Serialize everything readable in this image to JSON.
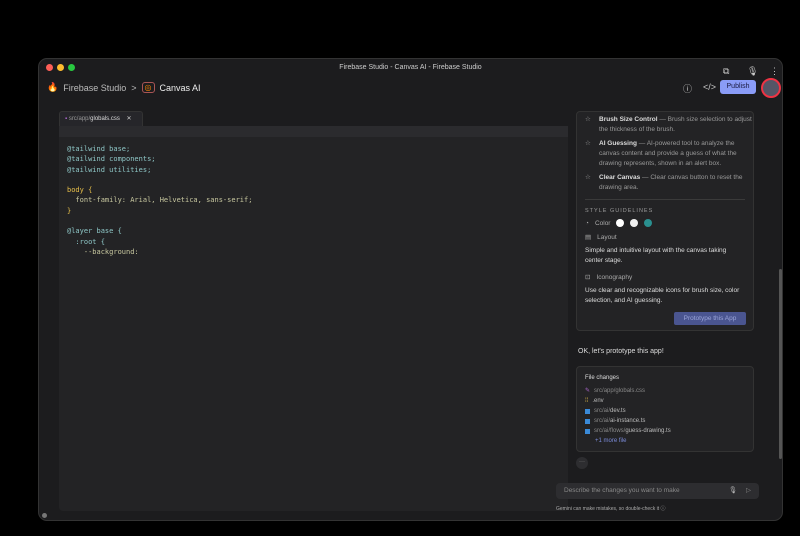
{
  "window": {
    "title": "Firebase Studio - Canvas AI - Firebase Studio"
  },
  "header": {
    "brand": "Firebase Studio",
    "separator": ">",
    "project": "Canvas AI",
    "publish_label": "Publish"
  },
  "editor": {
    "tab_dir": "src/app/",
    "tab_file": "globals.css",
    "code": [
      "@tailwind base;",
      "@tailwind components;",
      "@tailwind utilities;",
      "",
      "body {",
      "  font-family: Arial, Helvetica, sans-serif;",
      "}",
      "",
      "@layer base {",
      "  :root {",
      "    --background:"
    ]
  },
  "blueprint": {
    "features": [
      {
        "name": "Brush Size Control",
        "desc": "— Brush size selection to adjust the thickness of the brush."
      },
      {
        "name": "AI Guessing",
        "desc": "— AI-powered tool to analyze the canvas content and provide a guess of what the drawing represents, shown in an alert box."
      },
      {
        "name": "Clear Canvas",
        "desc": "— Clear canvas button to reset the drawing area."
      }
    ],
    "style_heading": "STYLE GUIDELINES",
    "color_label": "Color",
    "colors": [
      "#ffffff",
      "#f0f0f0",
      "#2a9090"
    ],
    "layout_label": "Layout",
    "layout_desc": "Simple and intuitive layout with the canvas taking center stage.",
    "icon_label": "Iconography",
    "icon_desc": "Use clear and recognizable icons for brush size, color selection, and AI guessing.",
    "prototype_label": "Prototype this App"
  },
  "response": "OK, let's prototype this app!",
  "file_changes": {
    "title": "File changes",
    "files": [
      {
        "dir": "src/app/",
        "name": "globals.css"
      },
      {
        "dir": "",
        "name": ".env"
      },
      {
        "dir": "src/ai/",
        "name": "dev.ts"
      },
      {
        "dir": "src/ai/",
        "name": "ai-instance.ts"
      },
      {
        "dir": "src/ai/flows/",
        "name": "guess-drawing.ts"
      }
    ],
    "more": "+1 more file"
  },
  "chat": {
    "placeholder": "Describe the changes you want to make",
    "note": "Gemini can make mistakes, so double-check it"
  }
}
